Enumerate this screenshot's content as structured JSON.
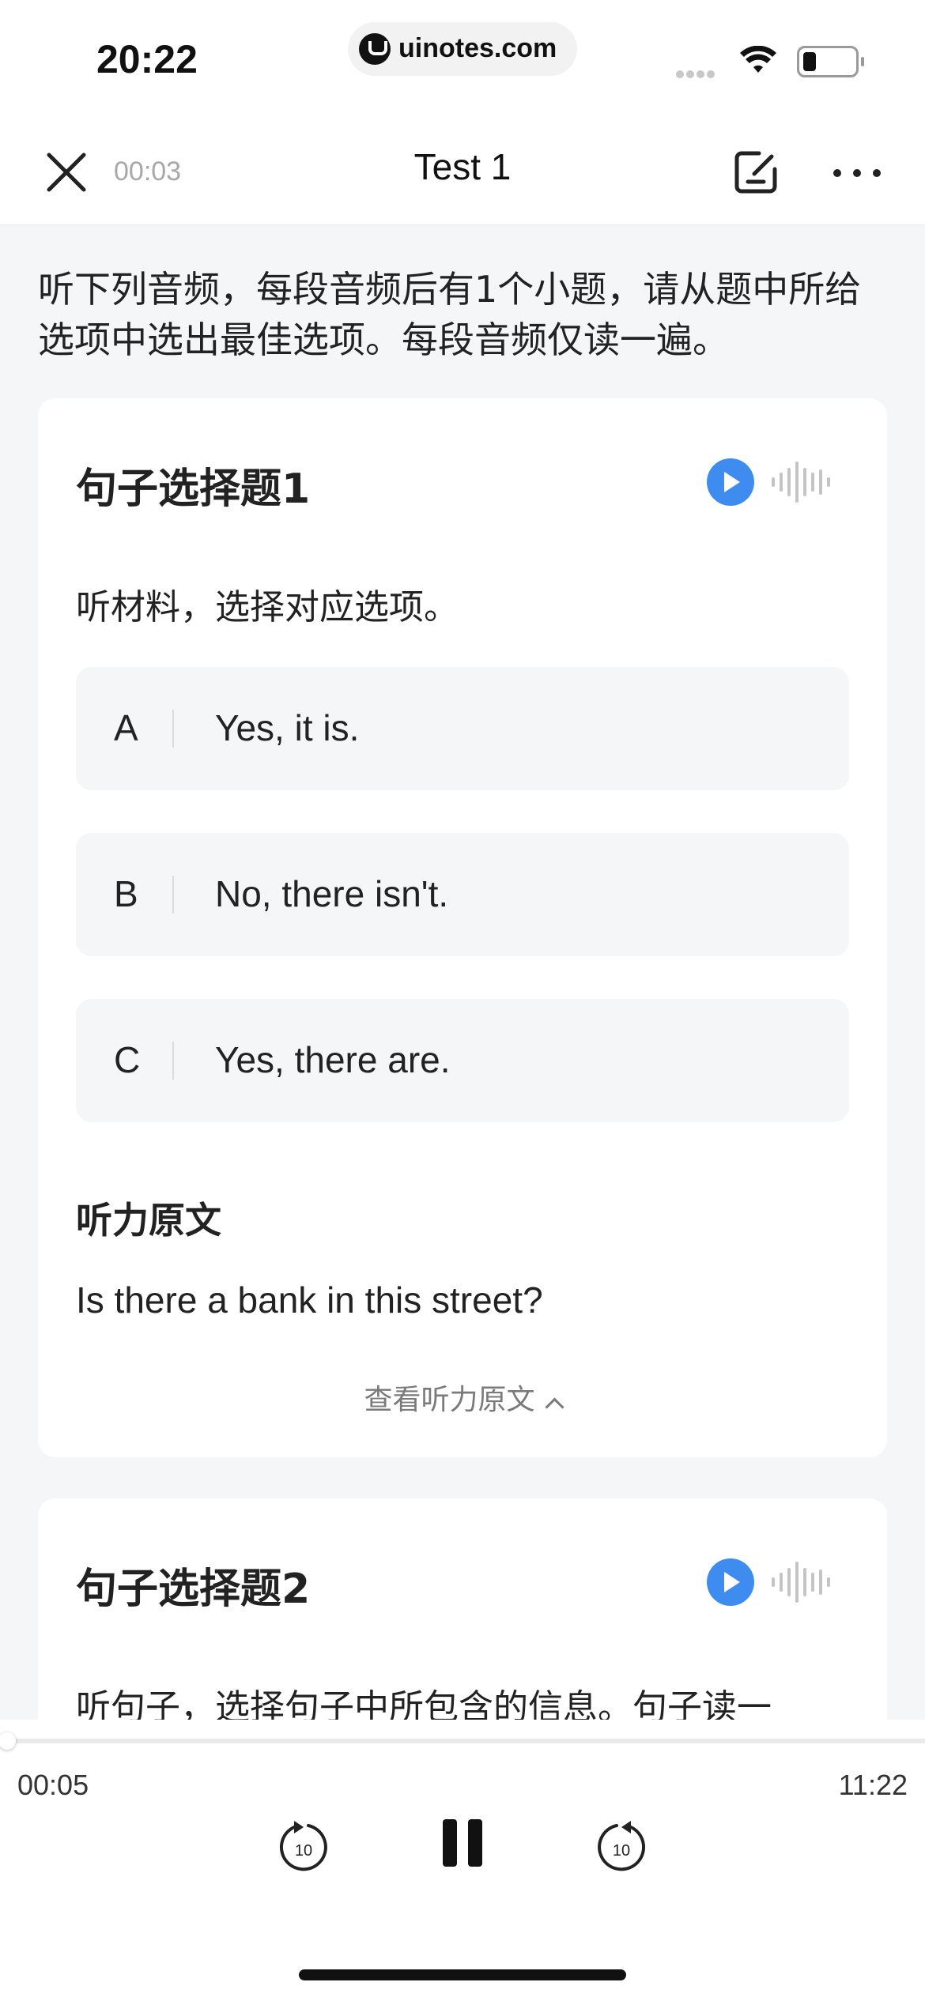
{
  "status_bar": {
    "time": "20:22",
    "url": "uinotes.com"
  },
  "nav": {
    "elapsed": "00:03",
    "title": "Test 1"
  },
  "instruction": "听下列音频，每段音频后有1个小题，请从题中所给选项中选出最佳选项。每段音频仅读一遍。",
  "question1": {
    "title": "句子选择题1",
    "prompt": "听材料，选择对应选项。",
    "options": [
      {
        "letter": "A",
        "text": "Yes, it is."
      },
      {
        "letter": "B",
        "text": "No, there isn't."
      },
      {
        "letter": "C",
        "text": "Yes, there are."
      }
    ],
    "transcript_heading": "听力原文",
    "transcript": "Is there a bank in this street?",
    "toggle_label": "查看听力原文"
  },
  "question2": {
    "title": "句子选择题2",
    "prompt": "听句子，选择句子中所包含的信息。句子读一"
  },
  "player": {
    "current_time": "00:05",
    "total_time": "11:22",
    "progress": 0.0073,
    "rewind_seconds": "10",
    "forward_seconds": "10"
  },
  "colors": {
    "accent": "#3f8cf0",
    "background": "#f5f6f8",
    "card": "#ffffff"
  }
}
